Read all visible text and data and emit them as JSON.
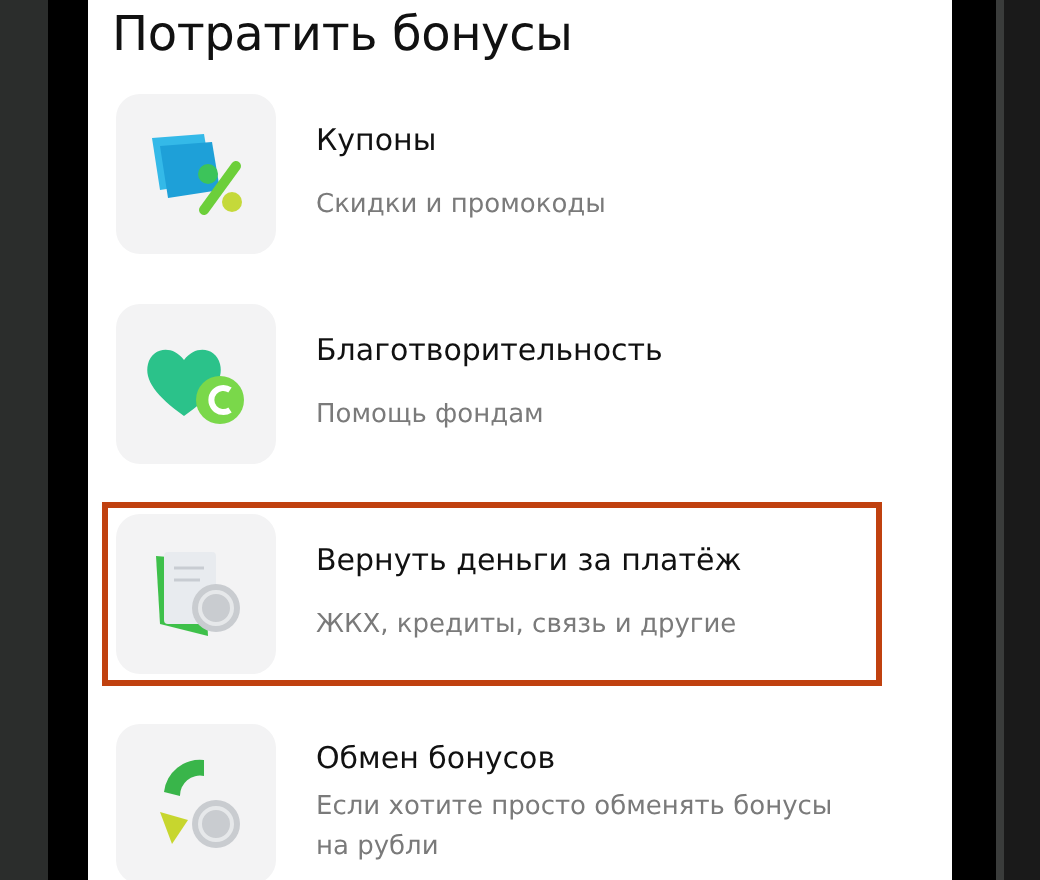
{
  "title": "Потратить бонусы",
  "items": [
    {
      "kind": "coupon",
      "title": "Купоны",
      "subtitle": "Скидки и промокоды",
      "highlighted": false
    },
    {
      "kind": "charity",
      "title": "Благотворительность",
      "subtitle": "Помощь фондам",
      "highlighted": false
    },
    {
      "kind": "refund",
      "title": "Вернуть деньги за платёж",
      "subtitle": "ЖКХ, кредиты, связь и другие",
      "highlighted": true
    },
    {
      "kind": "exchange",
      "title": "Обмен бонусов",
      "subtitle": "Если хотите просто обменять бонусы на рубли",
      "highlighted": false
    }
  ]
}
